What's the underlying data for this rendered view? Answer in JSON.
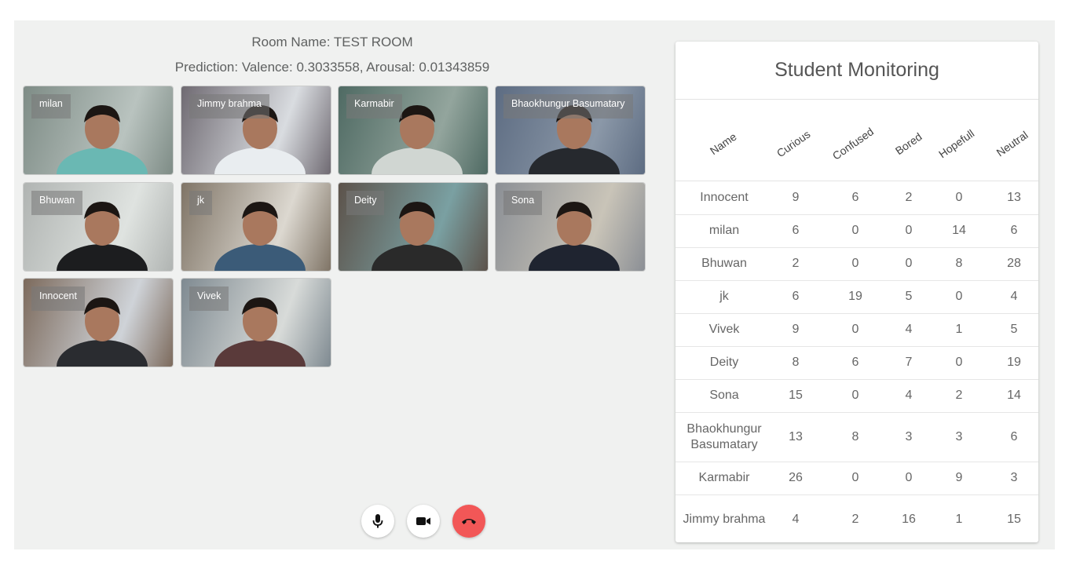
{
  "room": {
    "name_line": "Room Name: TEST ROOM",
    "prediction_line": "Prediction: Valence: 0.3033558, Arousal: 0.01343859"
  },
  "participants": [
    {
      "name": "milan"
    },
    {
      "name": "Jimmy brahma"
    },
    {
      "name": "Karmabir"
    },
    {
      "name": "Bhaokhungur Basumatary"
    },
    {
      "name": "Bhuwan"
    },
    {
      "name": "jk"
    },
    {
      "name": "Deity"
    },
    {
      "name": "Sona"
    },
    {
      "name": "Innocent"
    },
    {
      "name": "Vivek"
    }
  ],
  "monitoring": {
    "title": "Student Monitoring",
    "columns": [
      "Name",
      "Curious",
      "Confused",
      "Bored",
      "Hopefull",
      "Neutral"
    ],
    "rows": [
      {
        "name": "Innocent",
        "curious": "9",
        "confused": "6",
        "bored": "2",
        "hopefull": "0",
        "neutral": "13"
      },
      {
        "name": "milan",
        "curious": "6",
        "confused": "0",
        "bored": "0",
        "hopefull": "14",
        "neutral": "6"
      },
      {
        "name": "Bhuwan",
        "curious": "2",
        "confused": "0",
        "bored": "0",
        "hopefull": "8",
        "neutral": "28"
      },
      {
        "name": "jk",
        "curious": "6",
        "confused": "19",
        "bored": "5",
        "hopefull": "0",
        "neutral": "4"
      },
      {
        "name": "Vivek",
        "curious": "9",
        "confused": "0",
        "bored": "4",
        "hopefull": "1",
        "neutral": "5"
      },
      {
        "name": "Deity",
        "curious": "8",
        "confused": "6",
        "bored": "7",
        "hopefull": "0",
        "neutral": "19"
      },
      {
        "name": "Sona",
        "curious": "15",
        "confused": "0",
        "bored": "4",
        "hopefull": "2",
        "neutral": "14"
      },
      {
        "name": "Bhaokhungur Basumatary",
        "curious": "13",
        "confused": "8",
        "bored": "3",
        "hopefull": "3",
        "neutral": "6"
      },
      {
        "name": "Karmabir",
        "curious": "26",
        "confused": "0",
        "bored": "0",
        "hopefull": "9",
        "neutral": "3"
      },
      {
        "name": "Jimmy brahma",
        "curious": "4",
        "confused": "2",
        "bored": "16",
        "hopefull": "1",
        "neutral": "15"
      }
    ]
  },
  "controls": {
    "mic_icon": "microphone-icon",
    "camera_icon": "video-camera-icon",
    "hangup_icon": "phone-hangup-icon",
    "hangup_color": "#f25757"
  }
}
